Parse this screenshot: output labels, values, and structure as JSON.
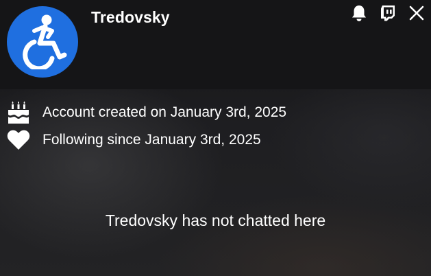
{
  "user": {
    "name": "Tredovsky",
    "avatar_icon": "wheelchair-accessibility-icon",
    "avatar_color": "#1f6fe0"
  },
  "actions": [
    {
      "icon": "bell-icon"
    },
    {
      "icon": "twitch-icon"
    },
    {
      "icon": "close-icon"
    }
  ],
  "info": {
    "account_created": "Account created on January 3rd, 2025",
    "following_since": "Following since January 3rd, 2025",
    "created_icon": "cake-icon",
    "following_icon": "heart-icon"
  },
  "chat_status": "Tredovsky has not chatted here"
}
